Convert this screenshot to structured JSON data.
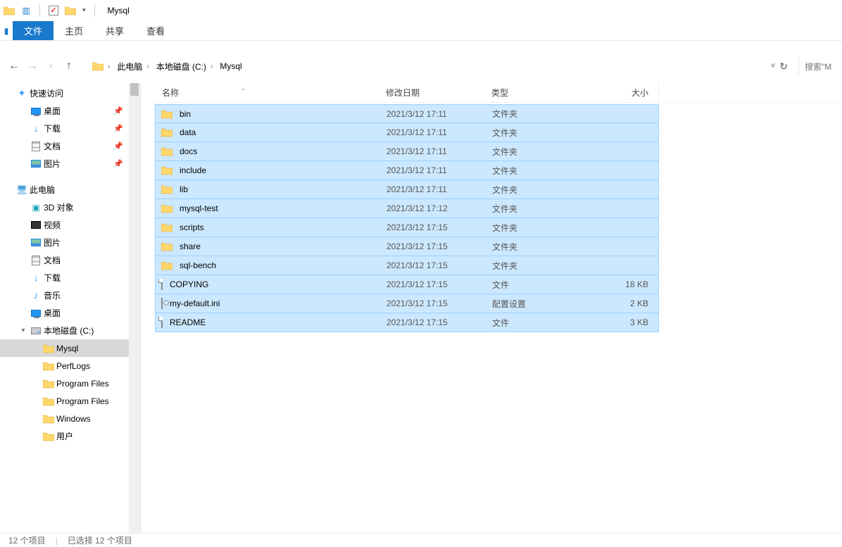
{
  "titlebar": {
    "title": "Mysql"
  },
  "ribbon": {
    "tabs": {
      "file": "文件",
      "home": "主页",
      "share": "共享",
      "view": "查看"
    }
  },
  "breadcrumb": {
    "segments": [
      "此电脑",
      "本地磁盘 (C:)",
      "Mysql"
    ]
  },
  "search": {
    "placeholder": "搜索\"M"
  },
  "navpane": {
    "quick_access": {
      "label": "快速访问",
      "items": [
        {
          "label": "桌面",
          "icon": "desktop",
          "pinned": true
        },
        {
          "label": "下载",
          "icon": "download",
          "pinned": true
        },
        {
          "label": "文档",
          "icon": "document",
          "pinned": true
        },
        {
          "label": "图片",
          "icon": "picture",
          "pinned": true
        }
      ]
    },
    "this_pc": {
      "label": "此电脑",
      "items": [
        {
          "label": "3D 对象",
          "icon": "3d"
        },
        {
          "label": "视频",
          "icon": "video"
        },
        {
          "label": "图片",
          "icon": "picture"
        },
        {
          "label": "文档",
          "icon": "document"
        },
        {
          "label": "下载",
          "icon": "download"
        },
        {
          "label": "音乐",
          "icon": "music"
        },
        {
          "label": "桌面",
          "icon": "desktop"
        },
        {
          "label": "本地磁盘 (C:)",
          "icon": "drive",
          "expanded": true,
          "children": [
            {
              "label": "Mysql",
              "icon": "folder",
              "selected": true
            },
            {
              "label": "PerfLogs",
              "icon": "folder"
            },
            {
              "label": "Program Files",
              "icon": "folder"
            },
            {
              "label": "Program Files",
              "icon": "folder"
            },
            {
              "label": "Windows",
              "icon": "folder"
            },
            {
              "label": "用户",
              "icon": "folder"
            }
          ]
        }
      ]
    }
  },
  "columns": {
    "name": "名称",
    "modified": "修改日期",
    "type": "类型",
    "size": "大小"
  },
  "files": [
    {
      "name": "bin",
      "modified": "2021/3/12 17:11",
      "type": "文件夹",
      "size": "",
      "kind": "folder"
    },
    {
      "name": "data",
      "modified": "2021/3/12 17:11",
      "type": "文件夹",
      "size": "",
      "kind": "folder"
    },
    {
      "name": "docs",
      "modified": "2021/3/12 17:11",
      "type": "文件夹",
      "size": "",
      "kind": "folder"
    },
    {
      "name": "include",
      "modified": "2021/3/12 17:11",
      "type": "文件夹",
      "size": "",
      "kind": "folder"
    },
    {
      "name": "lib",
      "modified": "2021/3/12 17:11",
      "type": "文件夹",
      "size": "",
      "kind": "folder"
    },
    {
      "name": "mysql-test",
      "modified": "2021/3/12 17:12",
      "type": "文件夹",
      "size": "",
      "kind": "folder"
    },
    {
      "name": "scripts",
      "modified": "2021/3/12 17:15",
      "type": "文件夹",
      "size": "",
      "kind": "folder"
    },
    {
      "name": "share",
      "modified": "2021/3/12 17:15",
      "type": "文件夹",
      "size": "",
      "kind": "folder"
    },
    {
      "name": "sql-bench",
      "modified": "2021/3/12 17:15",
      "type": "文件夹",
      "size": "",
      "kind": "folder"
    },
    {
      "name": "COPYING",
      "modified": "2021/3/12 17:15",
      "type": "文件",
      "size": "18 KB",
      "kind": "file"
    },
    {
      "name": "my-default.ini",
      "modified": "2021/3/12 17:15",
      "type": "配置设置",
      "size": "2 KB",
      "kind": "ini"
    },
    {
      "name": "README",
      "modified": "2021/3/12 17:15",
      "type": "文件",
      "size": "3 KB",
      "kind": "file"
    }
  ],
  "statusbar": {
    "count": "12 个项目",
    "selected": "已选择 12 个项目"
  }
}
